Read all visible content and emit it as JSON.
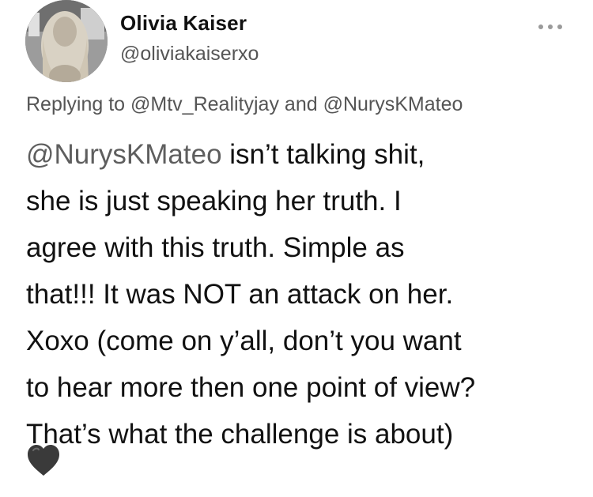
{
  "author": {
    "display_name": "Olivia Kaiser",
    "handle": "@oliviakaiserxo"
  },
  "reply": {
    "prefix": "Replying to",
    "mention_1": "@Mtv_Realityjay",
    "joiner": "and",
    "mention_2": "@NurysKMateo"
  },
  "tweet": {
    "lines": [
      {
        "mention": "@NurysKMateo",
        "text": " isn’t talking shit,"
      },
      {
        "text": "she is just speaking her truth. I"
      },
      {
        "text": "agree with this truth. Simple as"
      },
      {
        "text": "that!!! It was NOT an attack on her."
      },
      {
        "text": "Xoxo (come on y’all, don’t you want"
      },
      {
        "text": "to hear more then one point of view?"
      },
      {
        "text": "That’s what the challenge is about)"
      }
    ],
    "emoji": "black-heart-icon"
  },
  "icons": {
    "more": "more-horizontal-icon",
    "avatar": "profile-photo"
  },
  "colors": {
    "text": "#111111",
    "secondary": "#555555",
    "mention": "#5e5e5e",
    "heart": "#3a3a3a"
  }
}
